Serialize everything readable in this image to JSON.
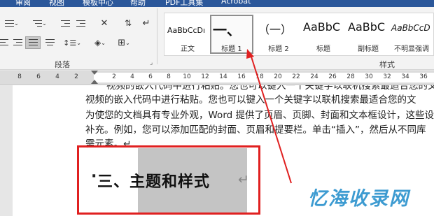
{
  "ribbon_tabs": [
    "审阅",
    "视图",
    "模板中心",
    "帮助",
    "PDF工具集",
    "Acrobat"
  ],
  "ribbon": {
    "paragraph_group_label": "段落",
    "styles_group_label": "样式",
    "styles": [
      {
        "sample": "AaBbCcDı",
        "name": "正文",
        "selected": false
      },
      {
        "sample": "一、",
        "name": "标题 1",
        "selected": true
      },
      {
        "sample": "（一）",
        "name": "标题 2",
        "selected": false
      },
      {
        "sample": "AaBbC",
        "name": "标题",
        "selected": false
      },
      {
        "sample": "AaBbC",
        "name": "副标题",
        "selected": false
      },
      {
        "sample": "AaBbCcD",
        "name": "不明显强调",
        "selected": false
      }
    ]
  },
  "ruler": {
    "gray_numbers": [
      "8",
      "6",
      "4",
      "2"
    ],
    "white_numbers": [
      "2",
      "4",
      "6",
      "8",
      "10",
      "12",
      "14",
      "16",
      "18",
      "20",
      "22",
      "24",
      "26",
      "28",
      "30",
      "32",
      "34",
      "36",
      "38",
      "40"
    ]
  },
  "document": {
    "lines": [
      "视频的嵌入代码中进行粘贴。您也可以键入一个关键字以联机搜索最适合您的文",
      "为使您的文档具有专业外观，Word 提供了页眉、页脚、封面和文本框设计，这些设",
      "补充。例如，您可以添加匹配的封面、页眉和提要栏。单击“插入”，然后从不同库",
      "需元素。↵"
    ],
    "heading_bullet": "·",
    "heading": "三、主题和样式",
    "paragraph_mark": "↵"
  },
  "watermark": "忆海收录网",
  "colors": {
    "annotation_red": "#e02020",
    "ribbon_blue": "#2b579a",
    "watermark_blue": "#3d9bd1"
  }
}
